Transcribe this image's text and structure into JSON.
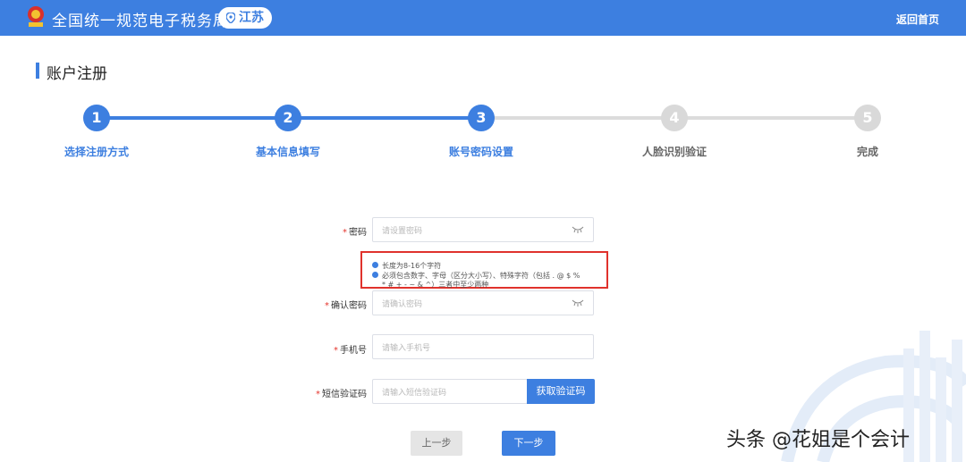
{
  "header": {
    "site_title": "全国统一规范电子税务局",
    "region": "江苏",
    "back_home": "返回首页",
    "bg_color": "#3d7fe0"
  },
  "page_title": "账户注册",
  "steps": [
    {
      "number": "1",
      "label": "选择注册方式",
      "state": "done"
    },
    {
      "number": "2",
      "label": "基本信息填写",
      "state": "done"
    },
    {
      "number": "3",
      "label": "账号密码设置",
      "state": "current"
    },
    {
      "number": "4",
      "label": "人脸识别验证",
      "state": "todo"
    },
    {
      "number": "5",
      "label": "完成",
      "state": "todo"
    }
  ],
  "form": {
    "password": {
      "label": "密码",
      "placeholder": "请设置密码"
    },
    "password_hints": [
      "长度为8-16个字符",
      "必须包含数字、字母（区分大小写）、特殊字符（包括 . @ $ %",
      "* #  + - ~ & ^）三者中至少两种"
    ],
    "confirm_password": {
      "label": "确认密码",
      "placeholder": "请确认密码"
    },
    "phone": {
      "label": "手机号",
      "placeholder": "请输入手机号"
    },
    "sms_code": {
      "label": "短信验证码",
      "placeholder": "请输入短信验证码",
      "button": "获取验证码"
    },
    "required_mark": "*"
  },
  "buttons": {
    "prev": "上一步",
    "next": "下一步"
  },
  "watermark": "头条 @花姐是个会计",
  "colors": {
    "accent": "#3d7fe0",
    "highlight_border": "#e0322c",
    "inactive": "#d9d9d9"
  }
}
